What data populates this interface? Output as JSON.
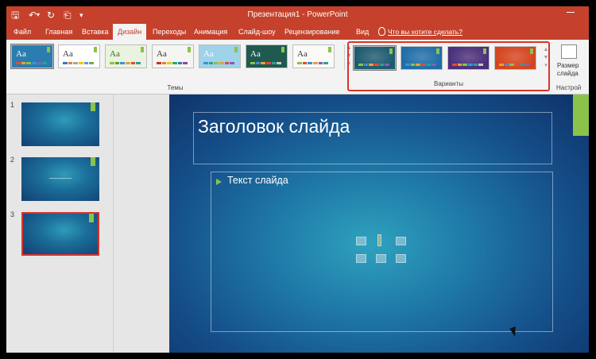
{
  "window": {
    "title": "Презентация1 - PowerPoint",
    "qat": [
      "save-icon",
      "undo-icon",
      "redo-icon",
      "slideshow-icon",
      "customize-icon"
    ]
  },
  "tabs": [
    {
      "label": "Файл"
    },
    {
      "label": "Главная"
    },
    {
      "label": "Вставка"
    },
    {
      "label": "Дизайн",
      "active": true
    },
    {
      "label": "Переходы"
    },
    {
      "label": "Анимация"
    },
    {
      "label": "Слайд-шоу"
    },
    {
      "label": "Рецензирование"
    },
    {
      "label": "Вид"
    }
  ],
  "tell_me": "Что вы хотите сделать?",
  "ribbon": {
    "themes_label": "Темы",
    "variants_label": "Варианты",
    "customize_label": "Настрой",
    "size_button": "Размер\nслайда",
    "themes": [
      {
        "sample": "Aa",
        "bg": "#2b7db0",
        "fg": "#ffffff",
        "colors": [
          "#e04c3c",
          "#f0a030",
          "#8bc34a",
          "#3e8edb",
          "#8a5cb8",
          "#2aa198"
        ],
        "selected": true
      },
      {
        "sample": "Aa",
        "bg": "#ffffff",
        "fg": "#333333",
        "colors": [
          "#4472c4",
          "#ed7d31",
          "#a5a5a5",
          "#ffc000",
          "#5b9bd5",
          "#70ad47"
        ]
      },
      {
        "sample": "Aa",
        "bg": "#eaf3df",
        "fg": "#2e6b1f",
        "colors": [
          "#8bc34a",
          "#5fa02a",
          "#3e8edb",
          "#f0a030",
          "#e04c3c",
          "#2aa198"
        ]
      },
      {
        "sample": "Aa",
        "bg": "#f5f5f2",
        "fg": "#333333",
        "colors": [
          "#c0392b",
          "#e67e22",
          "#f1c40f",
          "#27ae60",
          "#2980b9",
          "#8e44ad"
        ]
      },
      {
        "sample": "Aa",
        "bg": "#9ed3ea",
        "fg": "#ffffff",
        "colors": [
          "#3e8edb",
          "#2aa198",
          "#8bc34a",
          "#f0a030",
          "#e04c3c",
          "#8a5cb8"
        ]
      },
      {
        "sample": "Aa",
        "bg": "#1e5a4f",
        "fg": "#ffffff",
        "colors": [
          "#8bc34a",
          "#3e8edb",
          "#f0a030",
          "#e04c3c",
          "#2aa198",
          "#c8c8c8"
        ]
      },
      {
        "sample": "Aa",
        "bg": "#fafaf6",
        "fg": "#333333",
        "colors": [
          "#8bc34a",
          "#e04c3c",
          "#3e8edb",
          "#f0a030",
          "#8a5cb8",
          "#2aa198"
        ]
      }
    ],
    "variants": [
      {
        "bg": "#1e5a6e",
        "colors": [
          "#8bc34a",
          "#3e8edb",
          "#f0a030",
          "#e04c3c",
          "#2aa198",
          "#8a5cb8"
        ],
        "selected": true
      },
      {
        "bg": "#1f6ea6",
        "colors": [
          "#3e8edb",
          "#8bc34a",
          "#f0a030",
          "#e04c3c",
          "#2aa198",
          "#8a5cb8"
        ]
      },
      {
        "bg": "#4a2f7a",
        "colors": [
          "#e04c3c",
          "#f0a030",
          "#8bc34a",
          "#3e8edb",
          "#2aa198",
          "#c8c8c8"
        ]
      },
      {
        "bg": "#d4451f",
        "colors": [
          "#f0a030",
          "#3e8edb",
          "#8bc34a",
          "#e04c3c",
          "#2aa198",
          "#8a5cb8"
        ]
      }
    ]
  },
  "slides": [
    {
      "number": "1",
      "has_line": false,
      "active": false
    },
    {
      "number": "2",
      "has_line": true,
      "active": false
    },
    {
      "number": "3",
      "has_line": false,
      "active": true
    }
  ],
  "slide": {
    "title": "Заголовок слайда",
    "body": "Текст слайда",
    "placeholder_icons": [
      "table-icon",
      "chart-icon",
      "smartart-icon",
      "picture-icon",
      "online-picture-icon",
      "video-icon"
    ]
  },
  "colors": {
    "accent": "#c5412b",
    "green_accent": "#8bc34a",
    "highlight_red": "#d9342b"
  }
}
